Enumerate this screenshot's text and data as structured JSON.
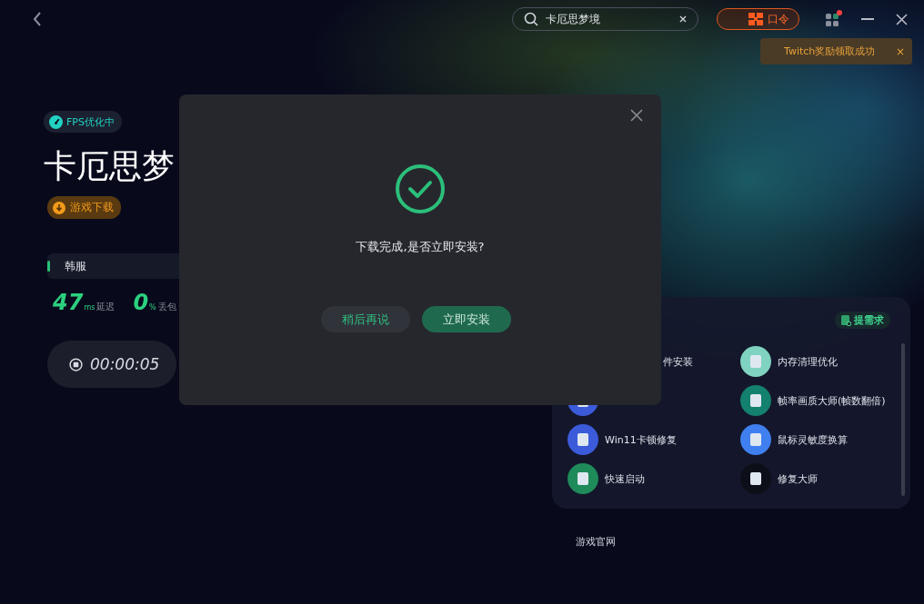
{
  "search": {
    "value": "卡厄思梦境"
  },
  "code_button": {
    "label": "口令"
  },
  "notification": {
    "unread": true
  },
  "toast": {
    "text": "Twitch奖励领取成功",
    "close": "×"
  },
  "game": {
    "status_badge": "FPS优化中",
    "title": "卡厄思梦",
    "download_button": "游戏下载",
    "server": "韩服",
    "latency": {
      "value": "47",
      "unit": "ms",
      "label": "延迟"
    },
    "loss": {
      "value": "0",
      "unit": "%",
      "label": "丢包"
    },
    "timer": "00:00:05"
  },
  "tools": {
    "request_button": "提需求",
    "items": [
      {
        "label": "件安装"
      },
      {
        "label": "内存清理优化",
        "color": "#7fd3c0"
      },
      {
        "color": "#3b5bdb"
      },
      {
        "label": "帧率画质大师(帧数翻倍)",
        "color": "#14806e"
      },
      {
        "label": "Win11卡顿修复",
        "color": "#3b5bdb"
      },
      {
        "label": "鼠标灵敏度换算",
        "color": "#3f7ff0"
      },
      {
        "label": "快速启动",
        "color": "#1f8a5a"
      },
      {
        "label": "修复大师",
        "color": "#0d0f18"
      }
    ]
  },
  "website_link": "游戏官网",
  "dialog": {
    "message": "下载完成,是否立即安装?",
    "buttons": [
      {
        "label": "稍后再说",
        "primary": false
      },
      {
        "label": "立即安装",
        "primary": true
      }
    ]
  }
}
